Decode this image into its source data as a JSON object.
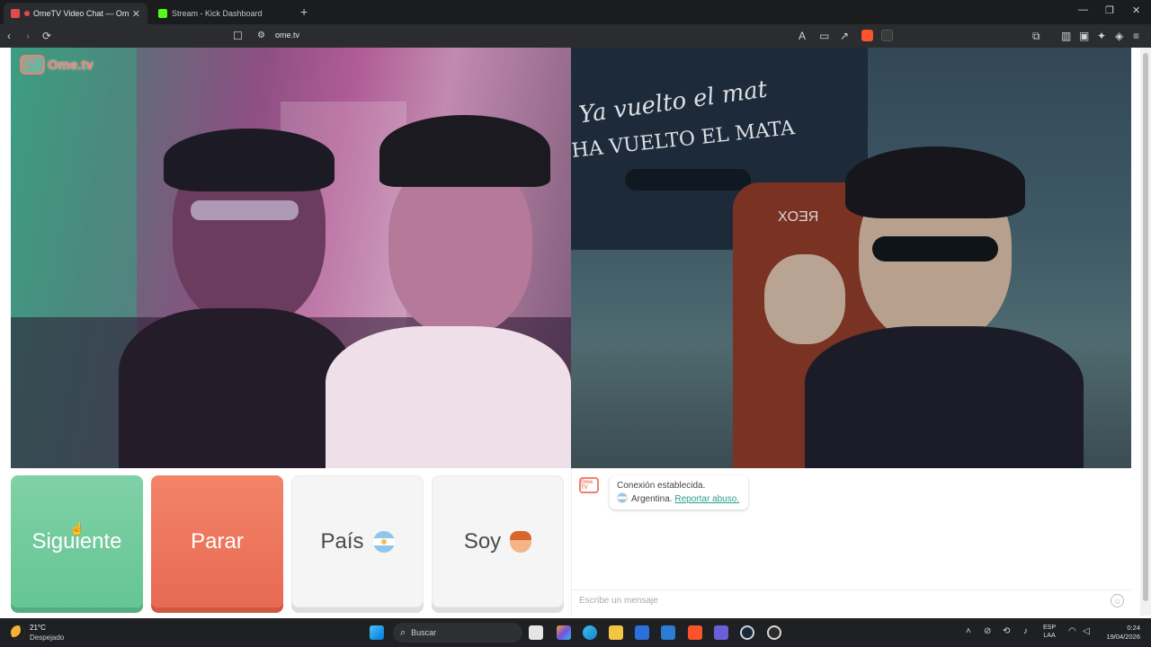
{
  "browser": {
    "tabs": [
      {
        "title": "OmeTV Video Chat — Omeg",
        "active": true
      },
      {
        "title": "Stream - Kick Dashboard",
        "active": false
      }
    ],
    "new_tab": "+",
    "url": "ome.tv",
    "window_controls": {
      "minimize": "—",
      "maximize": "❐",
      "close": "✕"
    }
  },
  "page": {
    "logo_badge": "Ome TV",
    "logo_text": "Ome.tv",
    "buttons": {
      "next": "Siguiente",
      "stop": "Parar",
      "country": "País",
      "gender": "Soy"
    },
    "chat": {
      "logo": "Ome TV",
      "status": "Conexión establecida.",
      "country": "Argentina.",
      "report": "Reportar abuso.",
      "input_placeholder": "Escribe un mensaje"
    }
  },
  "remote_video_overlay": {
    "line1": "Ya vuelto el mat",
    "line2": "HA VUELTO EL MATA"
  },
  "taskbar": {
    "weather_temp": "21°C",
    "weather_condition": "Despejado",
    "search_placeholder": "Buscar",
    "language": "ESP",
    "language_region": "LAA",
    "time": "0:24",
    "date": "19/04/2026"
  },
  "colors": {
    "next_button": "#66c594",
    "stop_button": "#e86a52",
    "brand": "#f08070",
    "link": "#2a9d8f"
  }
}
